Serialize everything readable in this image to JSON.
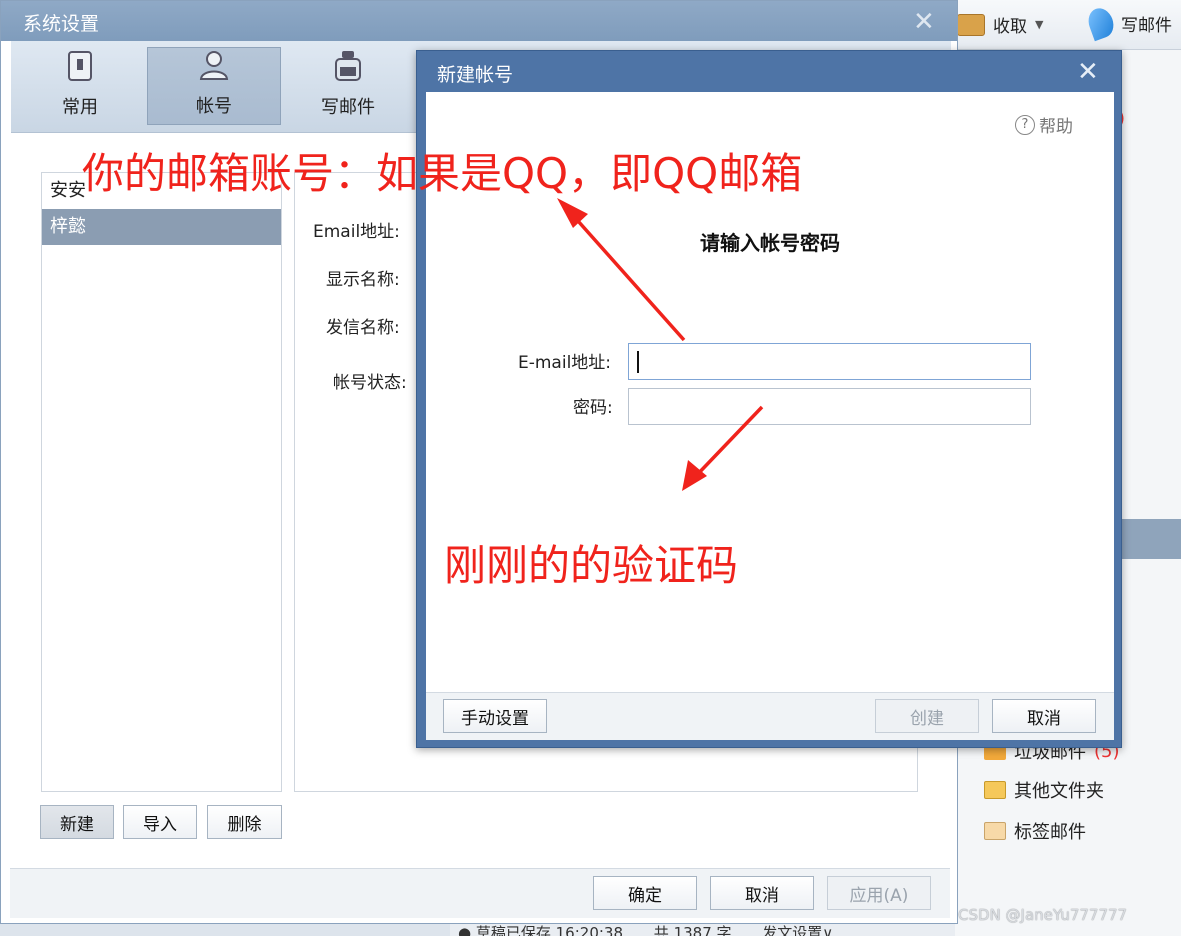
{
  "background_client": {
    "toolbar": {
      "receive_label": "收取",
      "compose_label": "写邮件"
    },
    "folders": [
      {
        "label": "垃圾邮件",
        "count": "(5)"
      },
      {
        "label": "其他文件夹"
      },
      {
        "label": "标签邮件"
      }
    ],
    "status": {
      "draft_saved": "草稿已保存 16:20:38",
      "word_count": "共 1387 字",
      "send_settings": "发文设置∨"
    }
  },
  "settings_window": {
    "title": "系统设置",
    "tabs": [
      {
        "label": "常用",
        "icon": "switch-icon"
      },
      {
        "label": "帐号",
        "icon": "user-icon",
        "active": true
      },
      {
        "label": "写邮件",
        "icon": "inkwell-icon"
      }
    ],
    "accounts": [
      {
        "name": "安安"
      },
      {
        "name": "梓懿",
        "selected": true
      }
    ],
    "detail_labels": {
      "email": "Email地址:",
      "display_name": "显示名称:",
      "sender_name": "发信名称:",
      "account_status": "帐号状态:"
    },
    "list_buttons": {
      "new": "新建",
      "import": "导入",
      "delete": "删除"
    },
    "footer_buttons": {
      "ok": "确定",
      "cancel": "取消",
      "apply": "应用(A)"
    }
  },
  "dialog": {
    "title": "新建帐号",
    "help_label": "帮助",
    "heading": "请输入帐号密码",
    "email_label": "E-mail地址:",
    "email_value": "",
    "password_label": "密码:",
    "password_value": "",
    "buttons": {
      "manual": "手动设置",
      "create": "创建",
      "cancel": "取消"
    }
  },
  "annotations": {
    "top": "你的邮箱账号：如果是QQ，即QQ邮箱",
    "bottom": "刚刚的的验证码"
  },
  "watermark": "CSDN @JaneYu777777",
  "colors": {
    "annotation_red": "#f0231c",
    "dialog_frame": "#4e74a6",
    "titlebar": "#8fa9c6"
  }
}
